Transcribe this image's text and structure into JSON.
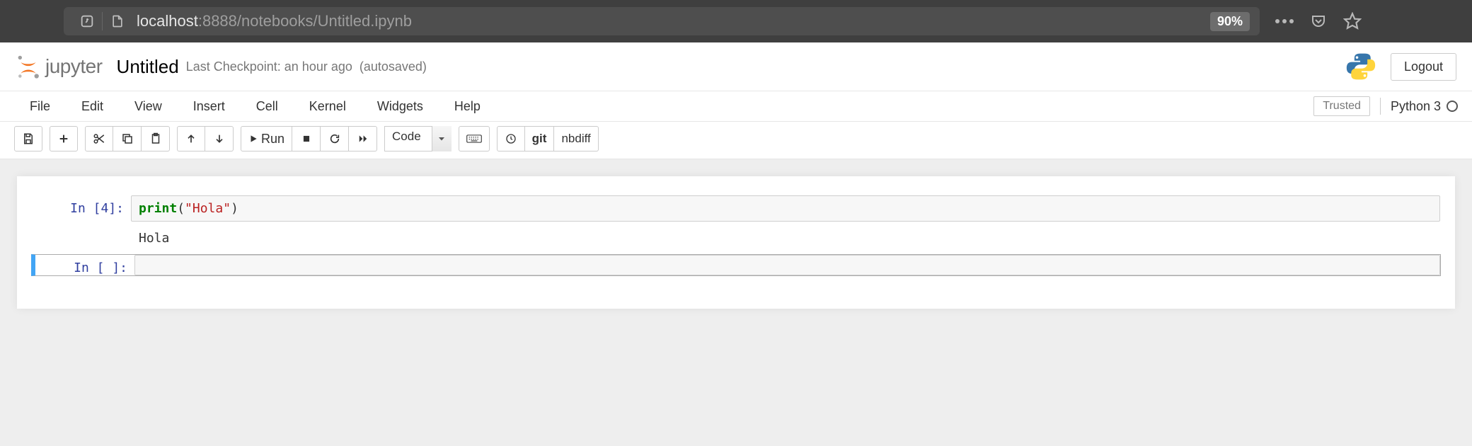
{
  "browser": {
    "url_host": "localhost",
    "url_port": ":8888",
    "url_path": "/notebooks/Untitled.ipynb",
    "zoom": "90%"
  },
  "header": {
    "brand": "jupyter",
    "notebook_name": "Untitled",
    "checkpoint": "Last Checkpoint: an hour ago",
    "autosave": "(autosaved)",
    "logout": "Logout"
  },
  "menu": {
    "items": [
      "File",
      "Edit",
      "View",
      "Insert",
      "Cell",
      "Kernel",
      "Widgets",
      "Help"
    ],
    "trusted": "Trusted",
    "kernel": "Python 3"
  },
  "toolbar": {
    "run_label": "Run",
    "cell_type": "Code",
    "git_label": "git",
    "nbdiff_label": "nbdiff"
  },
  "cells": [
    {
      "prompt": "In [4]:",
      "code_builtin": "print",
      "code_open": "(",
      "code_string": "\"Hola\"",
      "code_close": ")",
      "output": "Hola"
    },
    {
      "prompt": "In [ ]:",
      "code": ""
    }
  ]
}
